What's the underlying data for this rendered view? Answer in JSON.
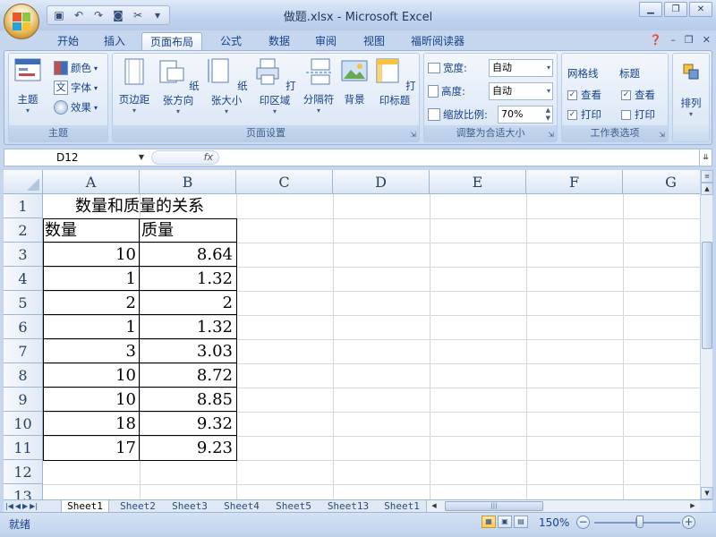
{
  "app": {
    "window_title": "做题.xlsx - Microsoft Excel",
    "accent": "#15428b"
  },
  "qat": {
    "icons": [
      "save-icon",
      "undo-icon",
      "redo-icon",
      "camera-icon",
      "tools-icon",
      "customize-icon"
    ]
  },
  "tabs": [
    {
      "label": "开始"
    },
    {
      "label": "插入"
    },
    {
      "label": "页面布局",
      "active": true
    },
    {
      "label": "公式"
    },
    {
      "label": "数据"
    },
    {
      "label": "审阅"
    },
    {
      "label": "视图"
    },
    {
      "label": "福昕阅读器"
    }
  ],
  "ribbon": {
    "theme_group": {
      "label": "主题",
      "theme_button": "主题",
      "colors": "颜色",
      "fonts": "字体",
      "effects": "效果",
      "font_icon_glyph": "文"
    },
    "page_setup_group": {
      "label": "页面设置",
      "margins": "页边距",
      "orientation": "纸张方向",
      "size": "纸张大小",
      "print_area": "打印区域",
      "breaks": "分隔符",
      "background": "背景",
      "print_titles": "打印标题"
    },
    "scale_group": {
      "label": "调整为合适大小",
      "width_label": "宽度:",
      "width_value": "自动",
      "height_label": "高度:",
      "height_value": "自动",
      "scale_label": "缩放比例:",
      "scale_value": "70%"
    },
    "sheet_options_group": {
      "label": "工作表选项",
      "gridlines": "网格线",
      "headings": "标题",
      "view": "查看",
      "print": "打印",
      "check_glyph": "✓",
      "gridlines_view_checked": true,
      "gridlines_print_checked": true,
      "headings_view_checked": true,
      "headings_print_checked": false
    },
    "arrange_group": {
      "label": "排列"
    }
  },
  "formula_bar": {
    "name_box": "D12",
    "fx": "fx",
    "value": ""
  },
  "grid": {
    "columns": [
      "A",
      "B",
      "C",
      "D",
      "E",
      "F",
      "G"
    ],
    "rows": [
      "1",
      "2",
      "3",
      "4",
      "5",
      "6",
      "7",
      "8",
      "9",
      "10",
      "11",
      "12",
      "13"
    ],
    "title": "数量和质量的关系",
    "header_quantity": "数量",
    "header_mass": "质量",
    "data": [
      {
        "qty": "10",
        "mass": "8.64"
      },
      {
        "qty": "1",
        "mass": "1.32"
      },
      {
        "qty": "2",
        "mass": "2"
      },
      {
        "qty": "1",
        "mass": "1.32"
      },
      {
        "qty": "3",
        "mass": "3.03"
      },
      {
        "qty": "10",
        "mass": "8.72"
      },
      {
        "qty": "10",
        "mass": "8.85"
      },
      {
        "qty": "18",
        "mass": "9.32"
      },
      {
        "qty": "17",
        "mass": "9.23"
      }
    ]
  },
  "sheets": [
    "Sheet1",
    "Sheet2",
    "Sheet3",
    "Sheet4",
    "Sheet5",
    "Sheet13",
    "Sheet1"
  ],
  "status": {
    "ready": "就绪",
    "zoom": "150%"
  }
}
